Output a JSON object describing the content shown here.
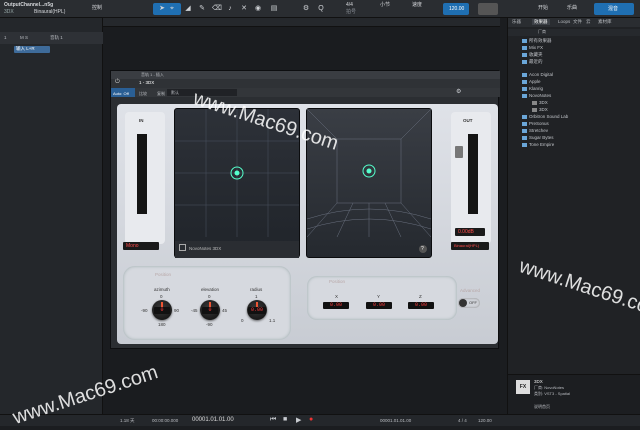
{
  "toolbar": {
    "song_title": "OutputChannel...n5g",
    "song_sub": "Binaural(HPL)",
    "edit_label": "控制",
    "plugin_label": "3DX",
    "time_sig_top": "4/4",
    "time_sig_label": "拍号",
    "key_label": "小节",
    "tempo_label": "速度",
    "tempo_value": "120.00",
    "start_label": "开始",
    "song_label": "乐曲",
    "mix_label": "混音"
  },
  "left_panel": {
    "track_num": "1",
    "track_name": "音轨 1",
    "track_fx": "M S",
    "input_label": "输入 L+R"
  },
  "plugin": {
    "window_title": "音轨 1 - 插入",
    "tab_label": "1 - 3DX",
    "auto_off": "Auto: Off",
    "compare": "比较",
    "copy_label": "复制",
    "preset_label": "默认",
    "in_label": "IN",
    "out_label": "OUT",
    "in_mode": "Mono",
    "out_value": "0.00dB",
    "out_mode": "Binaural(HPL)",
    "brand": "NovoNotes 3DX",
    "help": "?",
    "position_section": "Position",
    "azimuth_label": "azimuth",
    "elevation_label": "elevation",
    "radius_label": "radius",
    "azimuth_value": "0",
    "elevation_value": "0",
    "radius_value": "0.00",
    "az_ticks": [
      "0",
      "-90",
      "90",
      "180"
    ],
    "el_ticks": [
      "0",
      "-45",
      "45",
      "-90"
    ],
    "rad_ticks": [
      "1",
      "0",
      "1.1"
    ],
    "position2_section": "Position",
    "x_label": "X",
    "y_label": "Y",
    "z_label": "Z",
    "x_value": "0.00",
    "y_value": "0.00",
    "z_value": "0.00",
    "advanced_label": "Advanced",
    "advanced_toggle": "OFF"
  },
  "browser": {
    "tabs": [
      "乐器",
      "效果器",
      "Loops",
      "文件",
      "云",
      "素材库"
    ],
    "header": "厂商",
    "items": [
      "所有效果器",
      "Mix FX",
      "收藏夹",
      "最近的",
      "Acon Digital",
      "Apple",
      "Klanrig",
      "NovoNotes",
      "3DX",
      "3DX",
      "Orbitron Sound Lab",
      "PreSonus",
      "Stretchev",
      "Sugar Bytes",
      "Tone Empire"
    ],
    "info_badge": "FX",
    "info_name": "3DX",
    "info_vendor": "厂商: NovoNotes",
    "info_type": "类别: VST3 - Spatial",
    "info_footer": "说明首页"
  },
  "transport": {
    "sample_rate": "1.18 天",
    "time": "00:00:00.000",
    "bars": "00001.01.01.00",
    "loop_start": "00001.01.01.00",
    "sig": "4 / 4",
    "tempo": "120.00"
  },
  "watermarks": [
    "www.Mac69.com",
    "www.Mac69.com",
    "www.Mac69.com"
  ]
}
